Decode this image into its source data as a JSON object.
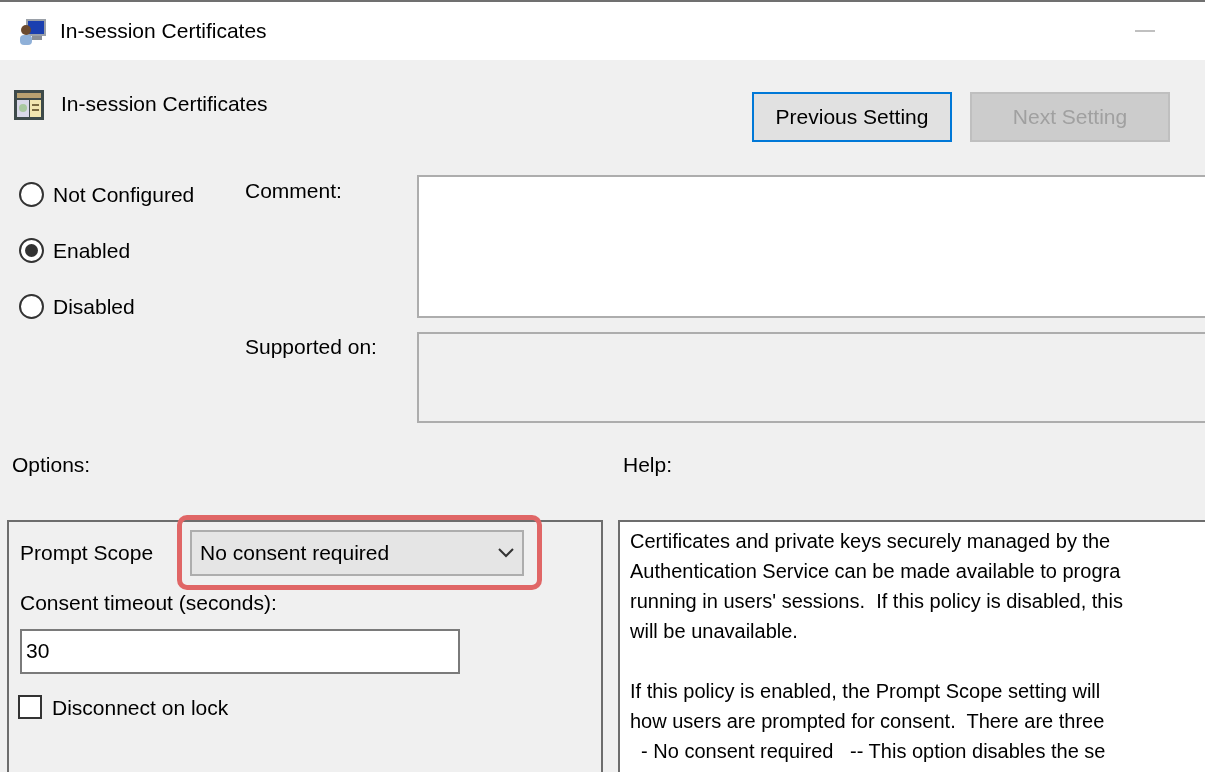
{
  "window": {
    "title": "In-session Certificates"
  },
  "header": {
    "title": "In-session Certificates"
  },
  "nav_buttons": [
    {
      "label": "Previous Setting",
      "disabled": false,
      "focused": true
    },
    {
      "label": "Next Setting",
      "disabled": true,
      "focused": false
    }
  ],
  "states": [
    {
      "label": "Not Configured",
      "selected": false
    },
    {
      "label": "Enabled",
      "selected": true
    },
    {
      "label": "Disabled",
      "selected": false
    }
  ],
  "comment": {
    "label": "Comment:"
  },
  "supported_on": {
    "label": "Supported on:"
  },
  "options_label": "Options:",
  "help_label": "Help:",
  "options": {
    "prompt_scope": {
      "label": "Prompt Scope",
      "value": "No consent required",
      "highlighted": true
    },
    "consent_timeout": {
      "label": "Consent timeout (seconds):",
      "value": "30"
    },
    "disconnect_on_lock": {
      "label": "Disconnect on lock",
      "checked": false
    }
  },
  "help_paragraphs": [
    [
      "Certificates and private keys securely managed by the",
      "Authentication Service can be made available to progra",
      "running in users' sessions.  If this policy is disabled, this",
      "will be unavailable."
    ],
    [
      "If this policy is enabled, the Prompt Scope setting will",
      "how users are prompted for consent.  There are three",
      "  - No consent required   -- This option disables the se"
    ]
  ]
}
